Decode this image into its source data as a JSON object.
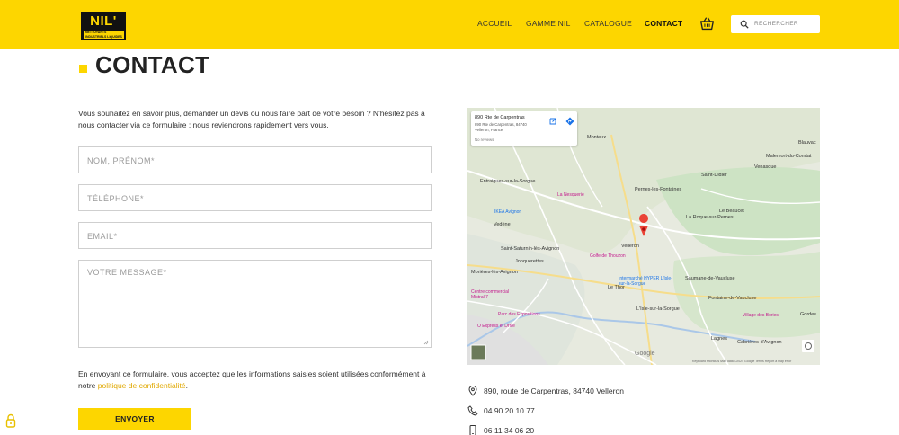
{
  "header": {
    "logo_text": "NIL'",
    "logo_sub": "NETTOYANTS INDUSTRIELS LIQUIDES",
    "nav": [
      {
        "label": "ACCUEIL"
      },
      {
        "label": "GAMME NIL"
      },
      {
        "label": "CATALOGUE"
      },
      {
        "label": "CONTACT",
        "active": true
      }
    ],
    "search_placeholder": "RECHERCHER"
  },
  "page": {
    "title": "CONTACT",
    "intro": "Vous souhaitez en savoir plus, demander un devis ou nous faire part de votre besoin ? N'hésitez pas à nous contacter via ce formulaire : nous reviendrons rapidement vers vous."
  },
  "form": {
    "name_placeholder": "NOM, PRÉNOM*",
    "phone_placeholder": "TÉLÉPHONE*",
    "email_placeholder": "EMAIL*",
    "message_placeholder": "VOTRE MESSAGE*",
    "consent_text": "En envoyant ce formulaire, vous acceptez que les informations saisies soient utilisées conformément à notre ",
    "consent_link": "politique de confidentialité",
    "consent_end": ".",
    "submit_label": "ENVOYER"
  },
  "map": {
    "place_title": "890 Rte de Carpentras",
    "place_address": "890 Rte de Carpentras, 84740 Velleron, France",
    "place_reviews": "No reviews",
    "labels": {
      "monteux": "Monteux",
      "entraigues": "Entraigues-sur-la-Sorgue",
      "pernes": "Pernes-les-Fontaines",
      "saint_didier": "Saint-Didier",
      "malemort": "Malemort-du-Comtat",
      "blauvac": "Blauvac",
      "venasque": "Venasque",
      "le_beaucet": "Le Beaucet",
      "la_roque": "La Roque-sur-Pernes",
      "la_nesquerie": "La Nesquerie",
      "ikea": "IKEA Avignon",
      "vedene": "Vedène",
      "velleron": "Velleron",
      "saint_saturnin": "Saint-Saturnin-lès-Avignon",
      "jonquerettes": "Jonquerettes",
      "golfe": "Golfe de Thouzon",
      "morieres": "Morières-lès-Avignon",
      "le_thor": "Le Thor",
      "intermarche": "Intermarché HYPER L'Isle-sur-la-Sorgue",
      "saumane": "Saumane-de-Vaucluse",
      "fontaine": "Fontaine-de-Vaucluse",
      "isle": "L'Isle-sur-la-Sorgue",
      "village_bories": "Village des Bories",
      "gordes": "Gordes",
      "centre_commercial": "Centre commercial Mistral 7",
      "parc_expo": "Parc des Expositions",
      "express": "O Express et Drive",
      "lagnes": "Lagnes",
      "cabrieres": "Cabrières-d'Avignon",
      "google": "Google",
      "footer": "Keyboard shortcuts   Map data ©2024 Google   Terms   Report a map error"
    }
  },
  "contact": {
    "address": "890, route de Carpentras, 84740 Velleron",
    "phone1": "04 90 20 10 77",
    "phone2": "06 11 34 06 20"
  }
}
